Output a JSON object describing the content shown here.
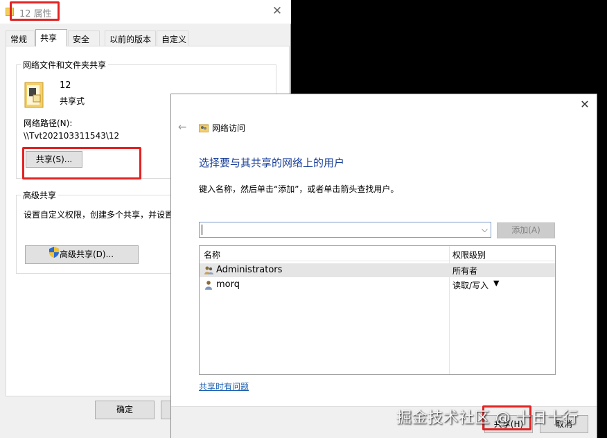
{
  "properties_window": {
    "title": "12 属性",
    "tabs": [
      "常规",
      "共享",
      "安全",
      "以前的版本",
      "自定义"
    ],
    "active_tab_index": 1,
    "network_group": {
      "label": "网络文件和文件夹共享",
      "folder_name": "12",
      "share_status": "共享式",
      "network_path_label": "网络路径(N):",
      "network_path": "\\\\Tvt202103311543\\12",
      "share_button": "共享(S)..."
    },
    "advanced_group": {
      "label": "高级共享",
      "description": "设置自定义权限，创建多个共享，并设置",
      "advanced_button": "高级共享(D)..."
    },
    "ok_button": "确定"
  },
  "network_dialog": {
    "header_title": "网络访问",
    "heading": "选择要与其共享的网络上的用户",
    "instruction": "键入名称，然后单击“添加”，或者单击箭头查找用户。",
    "input_value": "",
    "add_button": "添加(A)",
    "columns": {
      "name": "名称",
      "permission": "权限级别"
    },
    "rows": [
      {
        "name": "Administrators",
        "permission": "所有者",
        "selected": true
      },
      {
        "name": "morq",
        "permission": "读取/写入",
        "selected": false
      }
    ],
    "help_link": "共享时有问题",
    "share_button": "共享(H)",
    "cancel_button": "取消"
  },
  "watermark": "掘金技术社区 @ 十日十行",
  "colors": {
    "highlight": "#e32222",
    "heading": "#1a3f98",
    "link": "#1a5fb0"
  }
}
